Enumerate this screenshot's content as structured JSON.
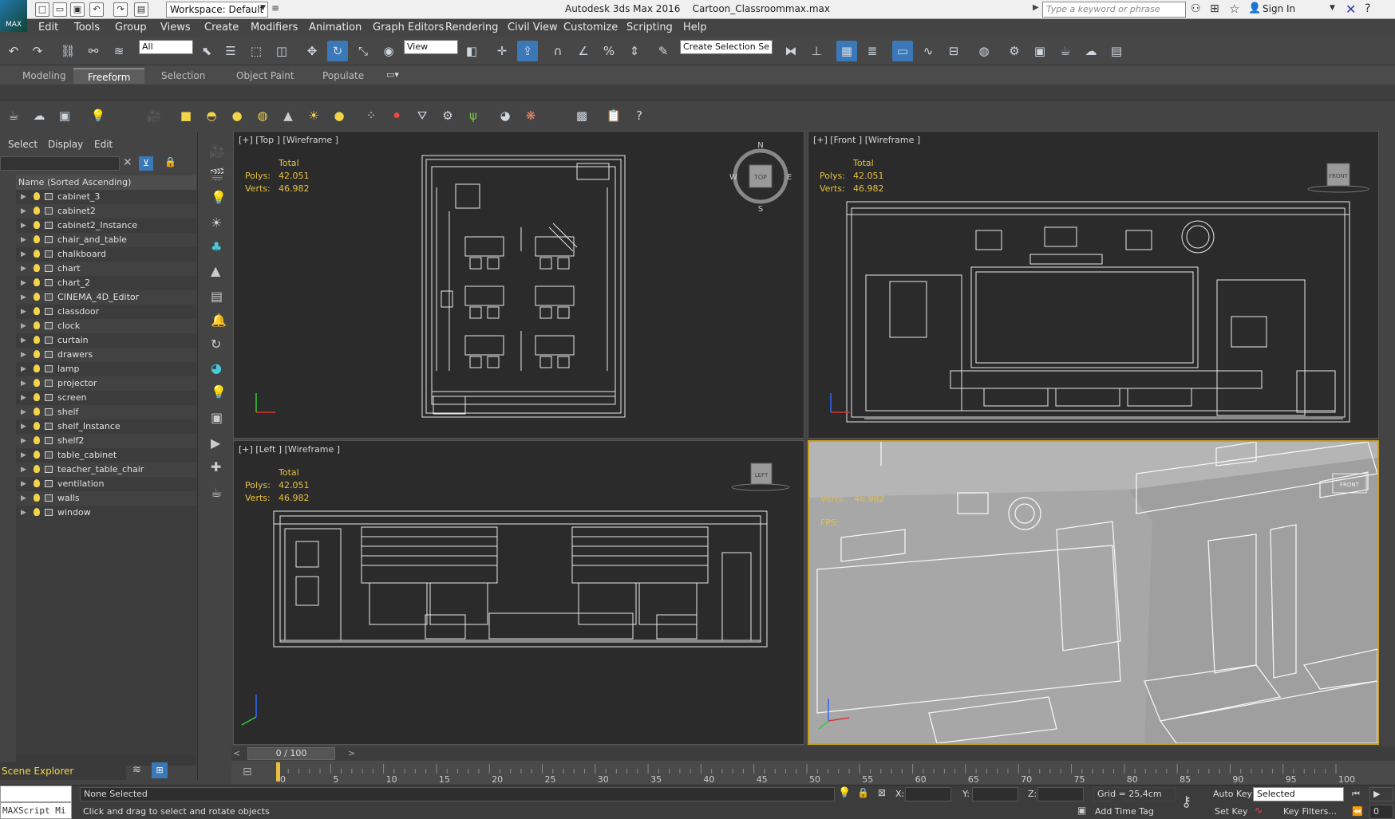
{
  "app": {
    "title": "Autodesk 3ds Max 2016",
    "file": "Cartoon_Classroommax.max",
    "logo_label": "MAX",
    "workspace": "Workspace: Default",
    "search_placeholder": "Type a keyword or phrase",
    "sign_in": "Sign In"
  },
  "menu": [
    "Edit",
    "Tools",
    "Group",
    "Views",
    "Create",
    "Modifiers",
    "Animation",
    "Graph Editors",
    "Rendering",
    "Civil View",
    "Customize",
    "Scripting",
    "Help"
  ],
  "toolbar": {
    "filter": "All",
    "ref_coord": "View",
    "selection_set": "Create Selection Se"
  },
  "ribbon_tabs": [
    "Modeling",
    "Freeform",
    "Selection",
    "Object Paint",
    "Populate"
  ],
  "ribbon_active": "Freeform",
  "explorer": {
    "menus": [
      "Select",
      "Display",
      "Edit"
    ],
    "column_header": "Name (Sorted Ascending)",
    "items": [
      "cabinet_3",
      "cabinet2",
      "cabinet2_Instance",
      "chair_and_table",
      "chalkboard",
      "chart",
      "chart_2",
      "CINEMA_4D_Editor",
      "classdoor",
      "clock",
      "curtain",
      "drawers",
      "lamp",
      "projector",
      "screen",
      "shelf",
      "shelf_Instance",
      "shelf2",
      "table_cabinet",
      "teacher_table_chair",
      "ventilation",
      "walls",
      "window"
    ],
    "footer": "Scene Explorer"
  },
  "viewports": {
    "top": {
      "label": "[+] [Top ] [Wireframe ]",
      "cube": "TOP"
    },
    "front": {
      "label": "[+] [Front ] [Wireframe ]",
      "cube": "FRONT"
    },
    "left": {
      "label": "[+] [Left ] [Wireframe ]",
      "cube": "LEFT"
    },
    "persp": {
      "cube": "FRONT",
      "fps_label": "FPS:"
    }
  },
  "stats": {
    "total": "Total",
    "polys_label": "Polys:",
    "polys": "42.051",
    "verts_label": "Verts:",
    "verts": "46.982"
  },
  "compass": {
    "n": "N",
    "s": "S",
    "e": "E",
    "w": "W"
  },
  "timeline": {
    "frame": "0 / 100",
    "ticks": [
      "0",
      "5",
      "10",
      "15",
      "20",
      "25",
      "30",
      "35",
      "40",
      "45",
      "50",
      "55",
      "60",
      "65",
      "70",
      "75",
      "80",
      "85",
      "90",
      "95",
      "100"
    ]
  },
  "status": {
    "maxscript": "MAXScript Mi",
    "selection": "None Selected",
    "prompt": "Click and drag to select and rotate objects",
    "x_label": "X:",
    "y_label": "Y:",
    "z_label": "Z:",
    "grid": "Grid = 25,4cm",
    "add_time_tag": "Add Time Tag",
    "auto_key": "Auto Key",
    "set_key": "Set Key",
    "key_mode": "Selected",
    "key_filters": "Key Filters...",
    "frame_field": "0"
  },
  "colors": {
    "stats": "#e8c040",
    "active_border": "#c9a020",
    "accent": "#3a78b8"
  }
}
